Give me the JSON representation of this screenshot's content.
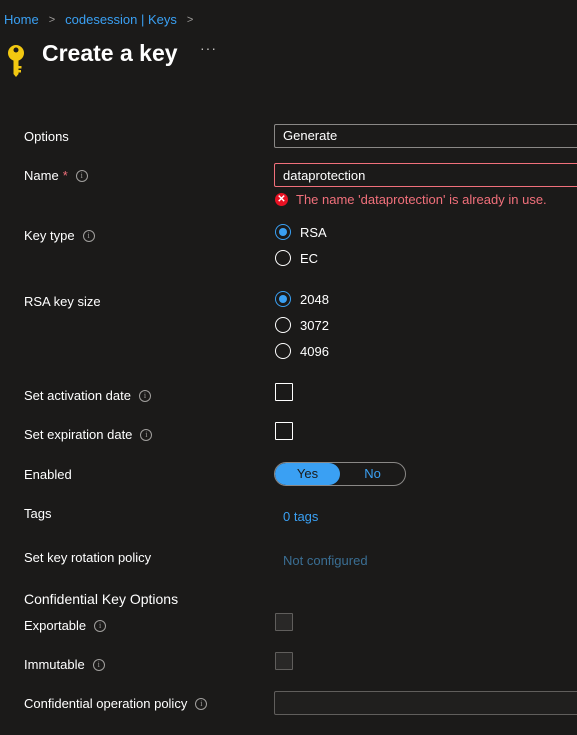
{
  "breadcrumb": {
    "items": [
      "Home",
      "codesession | Keys"
    ]
  },
  "header": {
    "title": "Create a key",
    "more": "···"
  },
  "form": {
    "options": {
      "label": "Options",
      "value": "Generate"
    },
    "name": {
      "label": "Name",
      "required_marker": "*",
      "value": "dataprotection",
      "error": "The name 'dataprotection' is already in use."
    },
    "key_type": {
      "label": "Key type",
      "options": [
        "RSA",
        "EC"
      ],
      "selected": "RSA"
    },
    "rsa_key_size": {
      "label": "RSA key size",
      "options": [
        "2048",
        "3072",
        "4096"
      ],
      "selected": "2048"
    },
    "activation_date": {
      "label": "Set activation date",
      "checked": false
    },
    "expiration_date": {
      "label": "Set expiration date",
      "checked": false
    },
    "enabled": {
      "label": "Enabled",
      "options": [
        "Yes",
        "No"
      ],
      "selected": "Yes"
    },
    "tags": {
      "label": "Tags",
      "value": "0 tags"
    },
    "rotation_policy": {
      "label": "Set key rotation policy",
      "value": "Not configured"
    },
    "confidential": {
      "section_title": "Confidential Key Options",
      "exportable": {
        "label": "Exportable",
        "checked": false,
        "disabled": true
      },
      "immutable": {
        "label": "Immutable",
        "checked": false,
        "disabled": true
      },
      "operation_policy": {
        "label": "Confidential operation policy",
        "value": ""
      }
    }
  },
  "icons": {
    "info": "i",
    "error": "✕",
    "chevron": "›"
  },
  "colors": {
    "accent": "#3aa0f3",
    "error": "#f1707b",
    "background": "#1b1a19"
  }
}
